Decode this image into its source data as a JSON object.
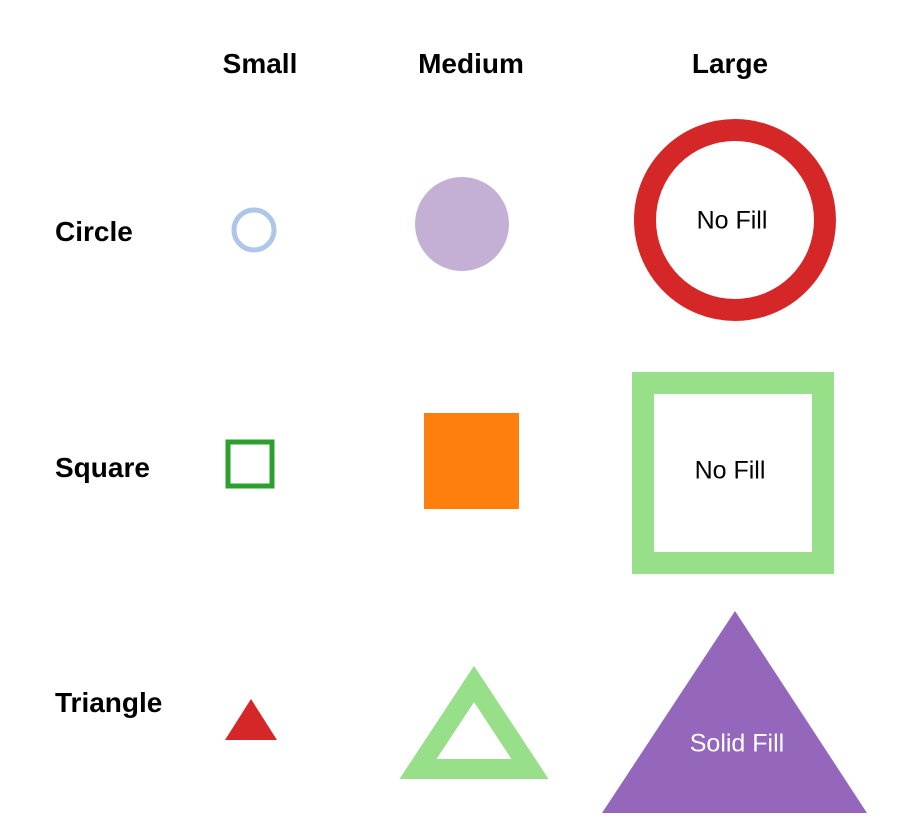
{
  "columns": [
    "Small",
    "Medium",
    "Large"
  ],
  "rows": [
    "Circle",
    "Square",
    "Triangle"
  ],
  "cells": {
    "circle_small": {
      "style": "outline",
      "color": "#aec7e8"
    },
    "circle_medium": {
      "style": "solid",
      "color": "#c5b0d5"
    },
    "circle_large": {
      "style": "outline",
      "color": "#d62728",
      "label": "No Fill",
      "label_color": "#000000"
    },
    "square_small": {
      "style": "outline",
      "color": "#2ca02c"
    },
    "square_medium": {
      "style": "solid",
      "color": "#ff7f0e"
    },
    "square_large": {
      "style": "outline",
      "color": "#98df8a",
      "label": "No Fill",
      "label_color": "#000000"
    },
    "triangle_small": {
      "style": "solid",
      "color": "#d62728"
    },
    "triangle_medium": {
      "style": "outline",
      "color": "#98df8a"
    },
    "triangle_large": {
      "style": "solid",
      "color": "#9467bd",
      "label": "Solid Fill",
      "label_color": "#ffffff"
    }
  }
}
